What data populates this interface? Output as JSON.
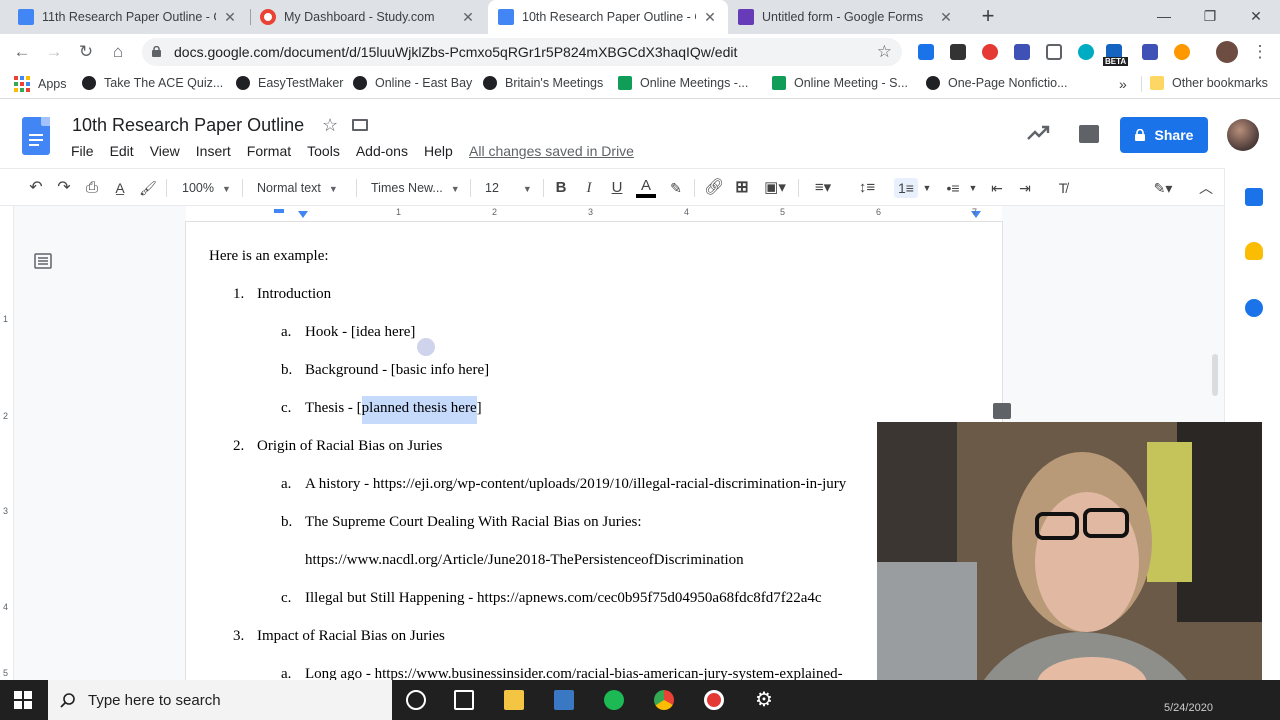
{
  "browser": {
    "tabs": [
      {
        "title": "11th Research Paper Outline - Go",
        "favicon": "docs-icon",
        "active": false
      },
      {
        "title": "My Dashboard - Study.com",
        "favicon": "study-icon",
        "active": false
      },
      {
        "title": "10th Research Paper Outline - Go",
        "favicon": "docs-icon",
        "active": true
      },
      {
        "title": "Untitled form - Google Forms",
        "favicon": "forms-icon",
        "active": false
      }
    ],
    "new_tab": "+",
    "url": "docs.google.com/document/d/15luuWjklZbs-Pcmxo5qRGr1r5P824mXBGCdX3haqIQw/edit",
    "bookmarks": [
      {
        "label": "Apps"
      },
      {
        "label": "Take The ACE Quiz..."
      },
      {
        "label": "EasyTestMaker"
      },
      {
        "label": "Online - East Bay"
      },
      {
        "label": "Britain's Meetings"
      },
      {
        "label": "Online Meetings -..."
      },
      {
        "label": "Online Meeting - S..."
      },
      {
        "label": "One-Page Nonfictio..."
      }
    ],
    "bookmarks_more": "»",
    "other_bookmarks": "Other bookmarks",
    "ext_badge": "BETA"
  },
  "docs": {
    "title": "10th Research Paper Outline",
    "menu": [
      "File",
      "Edit",
      "View",
      "Insert",
      "Format",
      "Tools",
      "Add-ons",
      "Help"
    ],
    "saved_status": "All changes saved in Drive",
    "share_label": "Share",
    "toolbar": {
      "zoom": "100%",
      "style": "Normal text",
      "font": "Times New...",
      "size": "12",
      "bold": "B",
      "italic": "I",
      "underline": "U",
      "text_color_glyph": "A",
      "text_color": "#000000"
    },
    "ruler_numbers": [
      "1",
      "2",
      "3",
      "4",
      "5",
      "6",
      "7"
    ],
    "vruler_numbers": [
      "1",
      "2",
      "3",
      "4",
      "5"
    ]
  },
  "document": {
    "intro": "Here is an example:",
    "items": [
      {
        "num": "1.",
        "text": "Introduction"
      },
      {
        "num": "a.",
        "text": "Hook - [idea here]"
      },
      {
        "num": "b.",
        "text": "Background - [basic info here]"
      },
      {
        "num": "c.",
        "text_before": "Thesis - [",
        "highlight": "planned thesis here",
        "text_after": "]"
      },
      {
        "num": "2.",
        "text": "Origin of Racial Bias on Juries"
      },
      {
        "num": "a.",
        "text": "A history - https://eji.org/wp-content/uploads/2019/10/illegal-racial-discrimination-in-jury"
      },
      {
        "num": "b.",
        "text": "The Supreme Court Dealing With Racial Bias on Juries:"
      },
      {
        "num": "",
        "text": "https://www.nacdl.org/Article/June2018-ThePersistenceofDiscrimination"
      },
      {
        "num": "c.",
        "text": "Illegal but Still Happening - https://apnews.com/cec0b95f75d04950a68fdc8fd7f22a4c"
      },
      {
        "num": "3.",
        "text": "Impact of Racial Bias on Juries"
      },
      {
        "num": "a.",
        "text": "Long ago - https://www.businessinsider.com/racial-bias-american-jury-system-explained-"
      }
    ]
  },
  "taskbar": {
    "search_placeholder": "Type here to search",
    "date": "5/24/2020"
  },
  "colors": {
    "accent": "#1a73e8",
    "docs_blue": "#4285f4",
    "highlight": "#c6dafc"
  }
}
